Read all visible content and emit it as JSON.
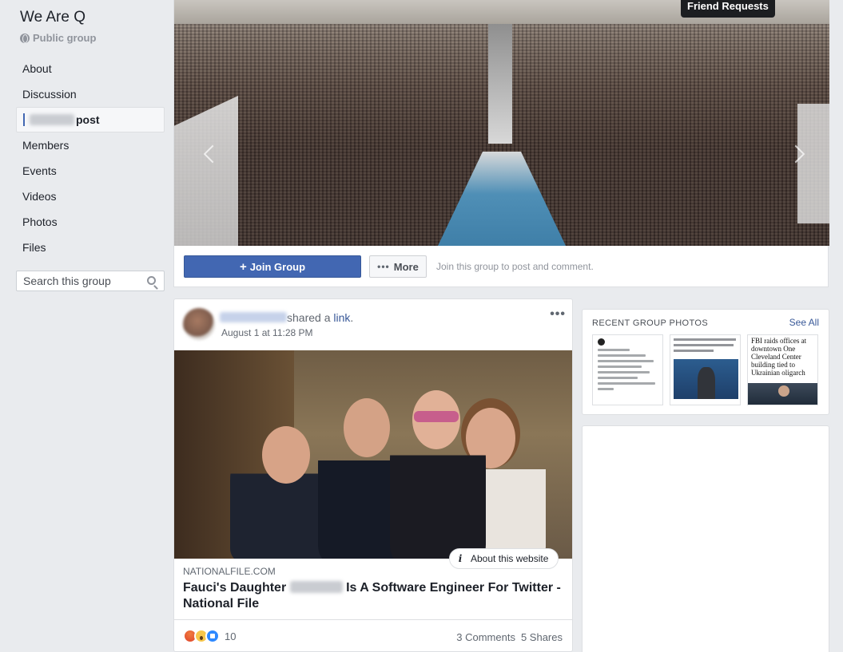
{
  "group": {
    "name": "We Are Q",
    "privacy": "Public group"
  },
  "nav": {
    "about": "About",
    "discussion": "Discussion",
    "active_suffix": "post",
    "members": "Members",
    "events": "Events",
    "videos": "Videos",
    "photos": "Photos",
    "files": "Files"
  },
  "search": {
    "placeholder": "Search this group"
  },
  "cover": {
    "friend_requests": "Friend Requests",
    "join_label": "Join Group",
    "more_label": "More",
    "join_hint": "Join this group to post and comment."
  },
  "post": {
    "shared_text": "shared a",
    "link_word": "link",
    "link_period": ".",
    "time": "August 1 at 11:28 PM",
    "options": "•••",
    "about_website": "About this website",
    "domain": "NATIONALFILE.COM",
    "title_part1": "Fauci's Daughter",
    "title_part2": "Is A Software Engineer For Twitter - National File",
    "reaction_count": "10",
    "comments": "3 Comments",
    "shares": "5 Shares"
  },
  "recent_photos": {
    "title": "RECENT GROUP PHOTOS",
    "see_all": "See All",
    "thumb3_headline": "FBI raids offices at downtown One Cleveland Center building tied to Ukrainian oligarch"
  },
  "icons": {
    "globe": "globe-icon",
    "search": "search-icon",
    "plus": "plus-icon",
    "more": "dots-icon",
    "info": "info-icon",
    "angry": "angry-icon",
    "wow": "wow-icon",
    "like": "like-icon"
  },
  "colors": {
    "brand_blue": "#4267b2",
    "link_blue": "#385898",
    "page_bg": "#e9ebee"
  }
}
